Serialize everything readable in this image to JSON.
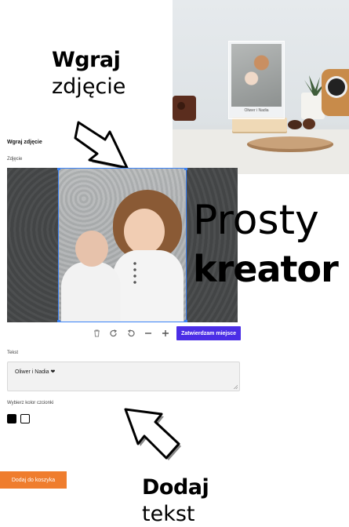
{
  "headlines": {
    "upload": {
      "bold": "Wgraj",
      "light": "zdjęcie"
    },
    "creator": {
      "light": "Prosty",
      "bold": "kreator"
    },
    "text": {
      "bold": "Dodaj",
      "light": "tekst"
    }
  },
  "product_photo": {
    "plate_caption": "Oliwer i Nadia"
  },
  "editor": {
    "title": "Wgraj zdjęcie",
    "photo_label": "Zdjęcie",
    "toolbar": {
      "delete_icon": "trash-icon",
      "rotate_right_icon": "rotate-right-icon",
      "rotate_left_icon": "rotate-left-icon",
      "zoom_out_icon": "minus-icon",
      "zoom_in_icon": "plus-icon",
      "confirm_label": "Zatwierdzam miejsce"
    },
    "text_label": "Tekst",
    "text_value": "Oliwer i Nadia ❤",
    "color_label": "Wybierz kolor czcionki",
    "colors": [
      "#000000",
      "#ffffff"
    ],
    "cart_label": "Dodaj do koszyka"
  },
  "colors": {
    "accent": "#4b2ee6",
    "cart": "#ef7d2e",
    "selection": "#3b82f6"
  }
}
